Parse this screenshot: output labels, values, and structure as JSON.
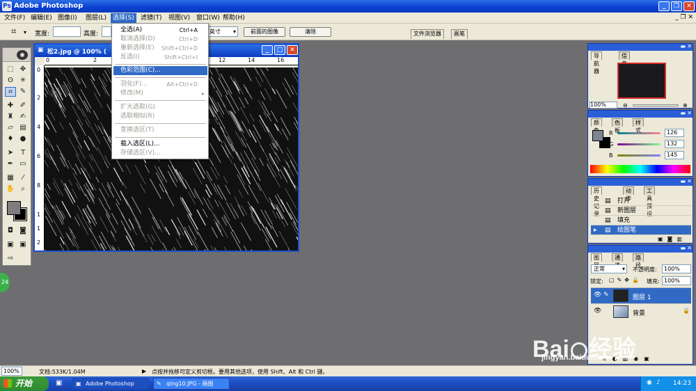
{
  "app": {
    "title": "Adobe Photoshop"
  },
  "menubar": {
    "items": [
      "文件(F)",
      "编辑(E)",
      "图像(I)",
      "图层(L)",
      "选择(S)",
      "滤镜(T)",
      "视图(V)",
      "窗口(W)",
      "帮助(H)"
    ]
  },
  "optionsbar": {
    "width_label": "宽度:",
    "height_label": "高度:",
    "unit": "英寸",
    "front_image_btn": "前面的图像",
    "clear_btn": "清除",
    "well_tabs": [
      "文件浏览器",
      "画笔"
    ]
  },
  "document": {
    "title": "松2.jpg @ 100% (",
    "ruler_h": [
      "0",
      "2",
      "12",
      "14",
      "16"
    ],
    "ruler_v": [
      "0",
      "2",
      "4",
      "6",
      "8",
      "1",
      "1",
      "2"
    ]
  },
  "select_menu": {
    "items": [
      {
        "label": "全选(A)",
        "shortcut": "Ctrl+A",
        "disabled": false
      },
      {
        "label": "取消选择(D)",
        "shortcut": "Ctrl+D",
        "disabled": true
      },
      {
        "label": "重新选择(E)",
        "shortcut": "Shift+Ctrl+D",
        "disabled": true
      },
      {
        "label": "反选(I)",
        "shortcut": "Shift+Ctrl+I",
        "disabled": true
      },
      {
        "label": "色彩范围(C)...",
        "shortcut": "",
        "disabled": false,
        "highlight": true
      },
      {
        "label": "羽化(F)...",
        "shortcut": "Alt+Ctrl+D",
        "disabled": true
      },
      {
        "label": "修改(M)",
        "shortcut": "▸",
        "disabled": true
      },
      {
        "label": "扩大选取(G)",
        "shortcut": "",
        "disabled": true
      },
      {
        "label": "选取相似(R)",
        "shortcut": "",
        "disabled": true
      },
      {
        "label": "变换选区(T)",
        "shortcut": "",
        "disabled": true
      },
      {
        "label": "载入选区(L)...",
        "shortcut": "",
        "disabled": false
      },
      {
        "label": "存储选区(V)...",
        "shortcut": "",
        "disabled": true
      }
    ]
  },
  "navigator": {
    "tabs": [
      "导航器",
      "信息"
    ],
    "zoom": "100%"
  },
  "color_palette": {
    "tabs": [
      "颜色",
      "色板",
      "样式"
    ],
    "channels": [
      {
        "name": "R",
        "value": "126"
      },
      {
        "name": "G",
        "value": "132"
      },
      {
        "name": "B",
        "value": "145"
      }
    ],
    "fg_color": "#7e8491"
  },
  "history": {
    "tabs": [
      "历史记录",
      "动作",
      "工具预设"
    ],
    "items": [
      "打开",
      "新图层",
      "填充",
      "绘图笔"
    ]
  },
  "layers": {
    "tabs": [
      "图层",
      "通道",
      "路径"
    ],
    "blend_mode": "正常",
    "opacity_label": "不透明度:",
    "opacity": "100%",
    "lock_label": "锁定:",
    "fill_label": "填充:",
    "fill": "100%",
    "items": [
      "图层 1",
      "背景"
    ]
  },
  "statusbar": {
    "zoom": "100%",
    "doc_info": "文档:533K/1.04M",
    "hint": "点按并拖移可定义剪切框。要用其他选项，使用 Shift、Alt 和 Ctrl 键。"
  },
  "taskbar": {
    "start": "开始",
    "tasks": [
      "Adobe Photoshop",
      "qing10.JPG - 画图"
    ],
    "clock": "14:23"
  },
  "watermark": {
    "brand": "Bai",
    "brand2": "经验",
    "url": "jingyan.baidu.com"
  },
  "badge": "24"
}
